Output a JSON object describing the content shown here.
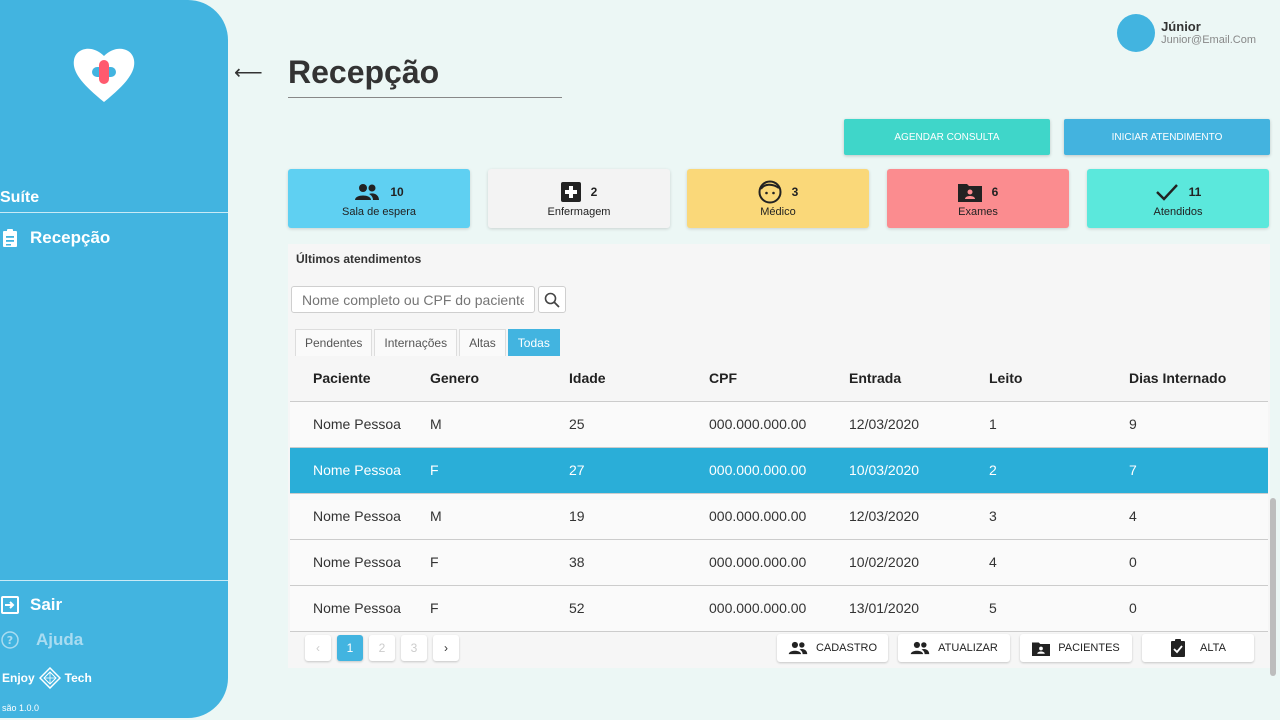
{
  "sidebar": {
    "suite_label": "Suíte",
    "nav": [
      {
        "label": "Recepção",
        "icon": "clipboard-icon"
      }
    ],
    "logout_label": "Sair",
    "help_label": "Ajuda",
    "brand_left": "Enjoy",
    "brand_right": "Tech",
    "version": "são 1.0.0"
  },
  "header": {
    "back_glyph": "⟵",
    "title": "Recepção"
  },
  "user": {
    "name": "Júnior",
    "email": "Junior@Email.Com"
  },
  "actions_top": {
    "agendar": "AGENDAR CONSULTA",
    "iniciar": "INICIAR ATENDIMENTO"
  },
  "stats": [
    {
      "label": "Sala de espera",
      "value": "10",
      "icon": "users-icon",
      "color": "#5fd0f2"
    },
    {
      "label": "Enfermagem",
      "value": "2",
      "icon": "plus-square-icon",
      "color": "#f3f3f3"
    },
    {
      "label": "Médico",
      "value": "3",
      "icon": "face-icon",
      "color": "#fad879"
    },
    {
      "label": "Exames",
      "value": "6",
      "icon": "folder-user-icon",
      "color": "#fb8c8f"
    },
    {
      "label": "Atendidos",
      "value": "11",
      "icon": "check-icon",
      "color": "#5be8dc"
    }
  ],
  "panel": {
    "title": "Últimos atendimentos",
    "search_placeholder": "Nome completo ou CPF do paciente",
    "tabs": [
      "Pendentes",
      "Internações",
      "Altas",
      "Todas"
    ],
    "active_tab": "Todas"
  },
  "table": {
    "columns": [
      "Paciente",
      "Genero",
      "Idade",
      "CPF",
      "Entrada",
      "Leito",
      "Dias Internado"
    ],
    "rows": [
      [
        "Nome Pessoa",
        "M",
        "25",
        "000.000.000.00",
        "12/03/2020",
        "1",
        "9"
      ],
      [
        "Nome Pessoa",
        "F",
        "27",
        "000.000.000.00",
        "10/03/2020",
        "2",
        "7"
      ],
      [
        "Nome Pessoa",
        "M",
        "19",
        "000.000.000.00",
        "12/03/2020",
        "3",
        "4"
      ],
      [
        "Nome Pessoa",
        "F",
        "38",
        "000.000.000.00",
        "10/02/2020",
        "4",
        "0"
      ],
      [
        "Nome Pessoa",
        "F",
        "52",
        "000.000.000.00",
        "13/01/2020",
        "5",
        "0"
      ]
    ],
    "selected_row": 1
  },
  "pagination": {
    "prev": "‹",
    "pages": [
      "1",
      "2",
      "3"
    ],
    "next": "›",
    "current": "1"
  },
  "bottom_actions": {
    "cadastro": "CADASTRO",
    "atualizar": "ATUALIZAR",
    "pacientes": "PACIENTES",
    "alta": "ALTA"
  }
}
